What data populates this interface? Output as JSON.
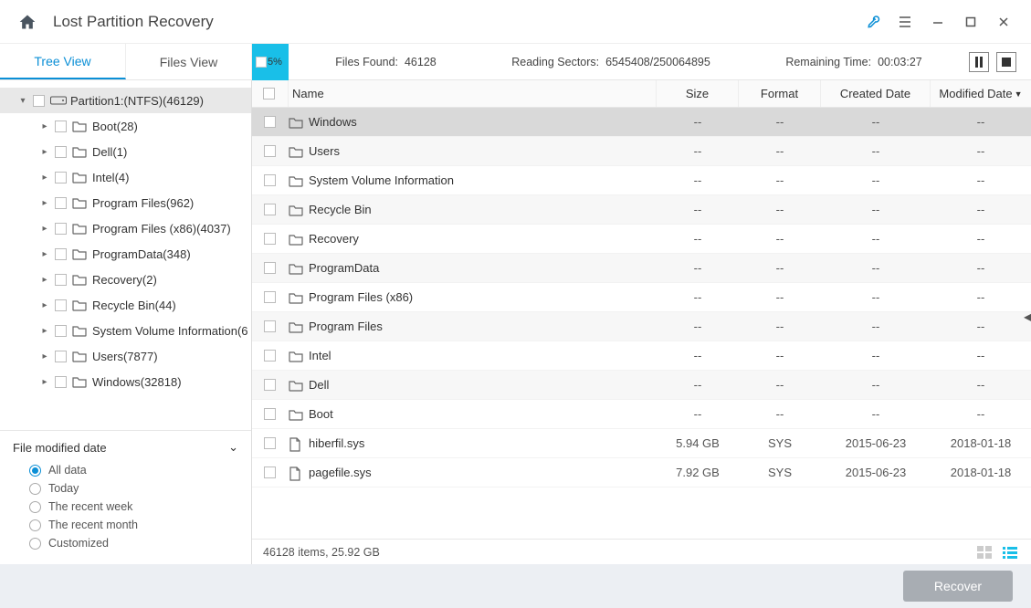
{
  "title": "Lost Partition Recovery",
  "tabs": {
    "tree": "Tree View",
    "files": "Files View"
  },
  "progress": {
    "percent": "5%"
  },
  "status": {
    "files_found_label": "Files Found:",
    "files_found": "46128",
    "reading_label": "Reading Sectors:",
    "reading": "6545408/250064895",
    "remaining_label": "Remaining Time:",
    "remaining": "00:03:27"
  },
  "tree": {
    "root": "Partition1:(NTFS)(46129)",
    "children": [
      "Boot(28)",
      "Dell(1)",
      "Intel(4)",
      "Program Files(962)",
      "Program Files (x86)(4037)",
      "ProgramData(348)",
      "Recovery(2)",
      "Recycle Bin(44)",
      "System Volume Information(6",
      "Users(7877)",
      "Windows(32818)"
    ]
  },
  "filter": {
    "title": "File modified date",
    "options": [
      "All data",
      "Today",
      "The recent week",
      "The recent month",
      "Customized"
    ],
    "selected": 0
  },
  "columns": {
    "name": "Name",
    "size": "Size",
    "format": "Format",
    "created": "Created Date",
    "modified": "Modified Date"
  },
  "rows": [
    {
      "type": "folder",
      "name": "Windows",
      "size": "--",
      "format": "--",
      "created": "--",
      "modified": "--",
      "sel": true
    },
    {
      "type": "folder",
      "name": "Users",
      "size": "--",
      "format": "--",
      "created": "--",
      "modified": "--"
    },
    {
      "type": "folder",
      "name": "System Volume Information",
      "size": "--",
      "format": "--",
      "created": "--",
      "modified": "--"
    },
    {
      "type": "folder",
      "name": "Recycle Bin",
      "size": "--",
      "format": "--",
      "created": "--",
      "modified": "--"
    },
    {
      "type": "folder",
      "name": "Recovery",
      "size": "--",
      "format": "--",
      "created": "--",
      "modified": "--"
    },
    {
      "type": "folder",
      "name": "ProgramData",
      "size": "--",
      "format": "--",
      "created": "--",
      "modified": "--"
    },
    {
      "type": "folder",
      "name": "Program Files (x86)",
      "size": "--",
      "format": "--",
      "created": "--",
      "modified": "--"
    },
    {
      "type": "folder",
      "name": "Program Files",
      "size": "--",
      "format": "--",
      "created": "--",
      "modified": "--"
    },
    {
      "type": "folder",
      "name": "Intel",
      "size": "--",
      "format": "--",
      "created": "--",
      "modified": "--"
    },
    {
      "type": "folder",
      "name": "Dell",
      "size": "--",
      "format": "--",
      "created": "--",
      "modified": "--"
    },
    {
      "type": "folder",
      "name": "Boot",
      "size": "--",
      "format": "--",
      "created": "--",
      "modified": "--"
    },
    {
      "type": "file",
      "name": "hiberfil.sys",
      "size": "5.94 GB",
      "format": "SYS",
      "created": "2015-06-23",
      "modified": "2018-01-18"
    },
    {
      "type": "file",
      "name": "pagefile.sys",
      "size": "7.92 GB",
      "format": "SYS",
      "created": "2015-06-23",
      "modified": "2018-01-18"
    }
  ],
  "statusline": "46128 items, 25.92 GB",
  "recover": "Recover"
}
